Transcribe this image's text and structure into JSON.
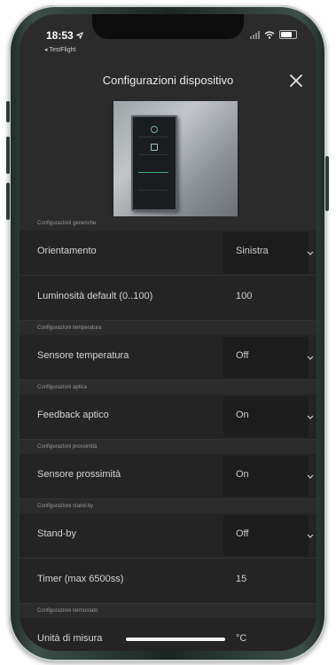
{
  "status_bar": {
    "time": "18:53",
    "back_app": "TestFlight"
  },
  "header": {
    "title": "Configurazioni dispositivo"
  },
  "sections": [
    {
      "label": "Configurazioni generiche",
      "rows": [
        {
          "label": "Orientamento",
          "value": "Sinistra",
          "dropdown": true
        },
        {
          "label": "Luminosità default (0..100)",
          "value": "100",
          "dropdown": false
        }
      ]
    },
    {
      "label": "Configurazioni temperatura",
      "rows": [
        {
          "label": "Sensore temperatura",
          "value": "Off",
          "dropdown": true
        }
      ]
    },
    {
      "label": "Configurazioni aptica",
      "rows": [
        {
          "label": "Feedback aptico",
          "value": "On",
          "dropdown": true
        }
      ]
    },
    {
      "label": "Configurazioni prossimità",
      "rows": [
        {
          "label": "Sensore prossimità",
          "value": "On",
          "dropdown": true
        }
      ]
    },
    {
      "label": "Configurazioni stand-by",
      "rows": [
        {
          "label": "Stand-by",
          "value": "Off",
          "dropdown": true
        },
        {
          "label": "Timer (max 6500ss)",
          "value": "15",
          "dropdown": false
        }
      ]
    },
    {
      "label": "Configurazioni termostato",
      "rows": [
        {
          "label": "Unità di misura",
          "value": "°C",
          "dropdown": false
        }
      ]
    }
  ],
  "colors": {
    "background": "#2b2b2b",
    "row_background": "#242424",
    "dropdown_background": "#1c1c1c",
    "text": "#d5d5d5",
    "section_label": "#9a9a9a"
  },
  "icons": [
    "location-arrow-icon",
    "back-arrow-icon",
    "signal-icon",
    "wifi-icon",
    "battery-icon",
    "close-icon",
    "chevron-down-icon"
  ]
}
